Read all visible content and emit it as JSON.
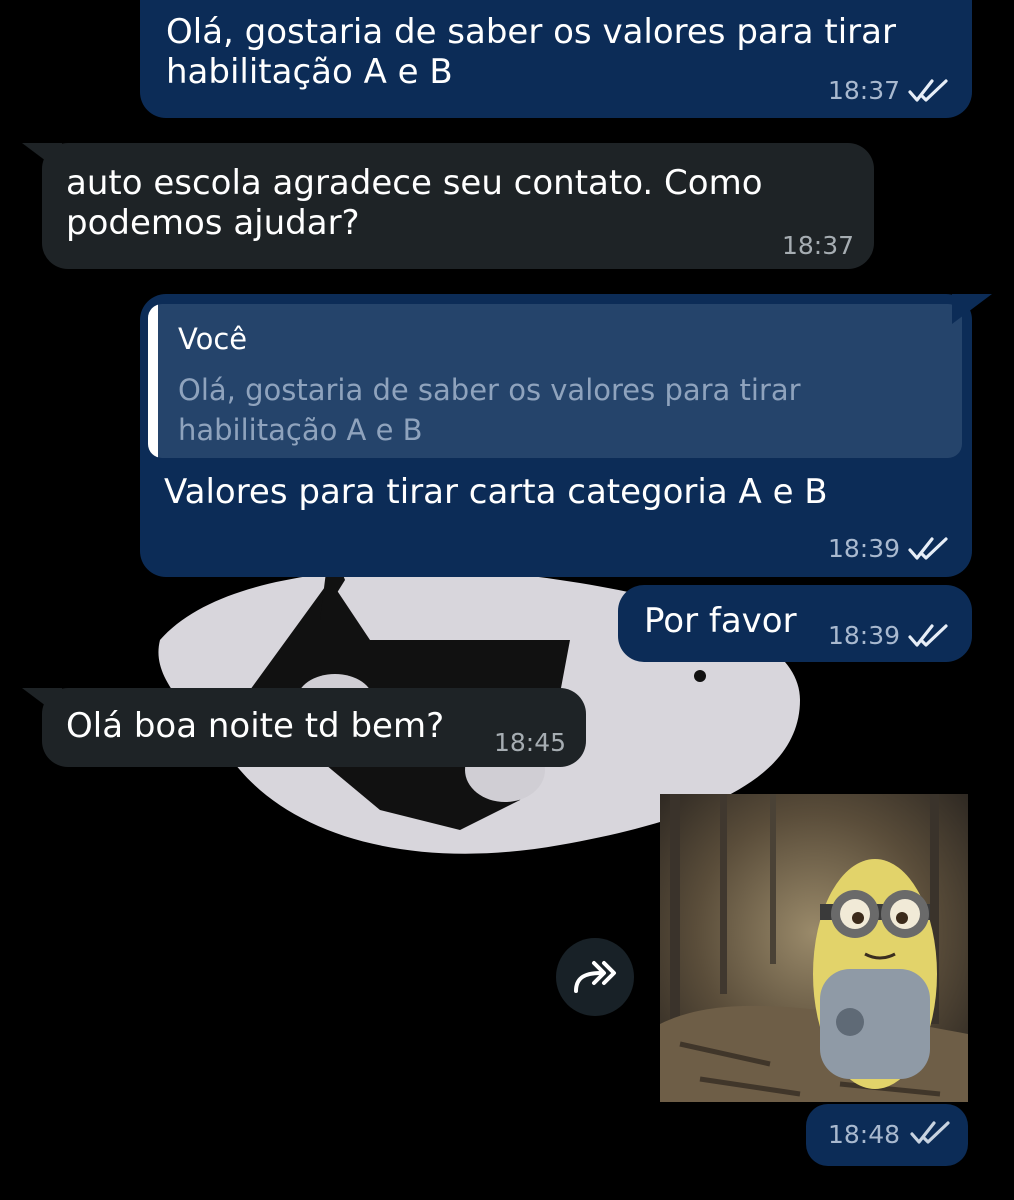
{
  "messages": [
    {
      "text": "Olá, gostaria de saber os valores para tirar\nhabilitação A e B",
      "time": "18:37"
    },
    {
      "text": "auto escola agradece seu contato. Como\npodemos ajudar?",
      "time": "18:37"
    },
    {
      "reply_author": "Você",
      "reply_text": "Olá, gostaria de saber os valores para tirar\nhabilitação A e B",
      "text": "Valores para tirar carta categoria A e B",
      "time": "18:39"
    },
    {
      "text": "Por favor",
      "time": "18:39"
    },
    {
      "text": "Olá boa noite td bem?",
      "time": "18:45"
    },
    {
      "time": "18:48"
    }
  ],
  "icons": {
    "read_receipt": "double-check-icon",
    "forward": "forward-share-icon"
  },
  "colors": {
    "outgoing_bubble": "#0c2c57",
    "incoming_bubble": "#1e2326",
    "quote_background": "#25446b",
    "background": "#000000"
  }
}
